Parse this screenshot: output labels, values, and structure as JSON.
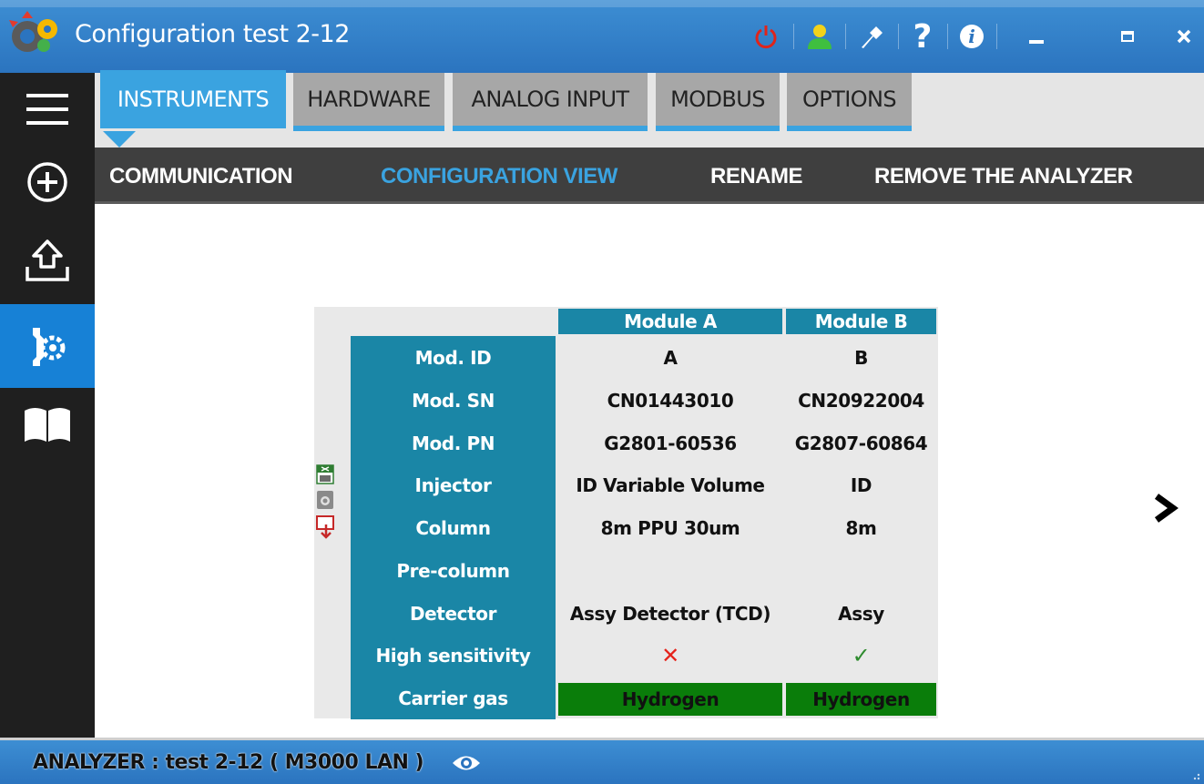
{
  "window": {
    "title": "Configuration test 2-12",
    "icons": [
      "app-logo-icon",
      "power-icon",
      "user-icon",
      "tools-icon",
      "help-icon",
      "info-icon",
      "minimize-icon",
      "maximize-icon",
      "close-icon"
    ],
    "help_glyph": "?",
    "info_glyph": "i"
  },
  "sidebar": {
    "items": [
      {
        "icon": "menu-icon"
      },
      {
        "icon": "add-icon"
      },
      {
        "icon": "upload-icon"
      },
      {
        "icon": "configuration-icon",
        "active": true
      },
      {
        "icon": "book-icon"
      }
    ]
  },
  "tabs": [
    {
      "label": "INSTRUMENTS",
      "active": true
    },
    {
      "label": "HARDWARE"
    },
    {
      "label": "ANALOG INPUT"
    },
    {
      "label": "MODBUS"
    },
    {
      "label": "OPTIONS"
    }
  ],
  "submenu": [
    {
      "label": "COMMUNICATION"
    },
    {
      "label": "CONFIGURATION VIEW",
      "active": true
    },
    {
      "label": "RENAME"
    },
    {
      "label": "REMOVE THE ANALYZER"
    }
  ],
  "config_table": {
    "columns": [
      "Module A",
      "Module B"
    ],
    "rows": [
      {
        "label": "Mod. ID",
        "a": "A",
        "b": "B"
      },
      {
        "label": "Mod. SN",
        "a": "CN01443010",
        "b": "CN20922004"
      },
      {
        "label": "Mod. PN",
        "a": "G2801-60536",
        "b": "G2807-60864"
      },
      {
        "label": "Injector",
        "a": "ID Variable Volume",
        "b": "ID"
      },
      {
        "label": "Column",
        "a": "8m PPU 30um",
        "b": "8m"
      },
      {
        "label": "Pre-column",
        "a": "",
        "b": ""
      },
      {
        "label": "Detector",
        "a": "Assy Detector (TCD)",
        "b": "Assy"
      },
      {
        "label": "High sensitivity",
        "a": "✕",
        "b": "✓"
      },
      {
        "label": "Carrier gas",
        "a": "Hydrogen",
        "b": "Hydrogen"
      }
    ],
    "colors": {
      "header": "#1a86a6",
      "gas": "#0a7d0a",
      "cross": "#e5231b",
      "check": "#2e8b2e"
    },
    "side_icons": [
      "excel-export-icon",
      "camera-icon",
      "pdf-export-icon"
    ]
  },
  "status": {
    "text": "ANALYZER :  test 2-12 ( M3000 LAN )",
    "icon": "eye-icon"
  },
  "next_icon": "chevron-right-icon"
}
